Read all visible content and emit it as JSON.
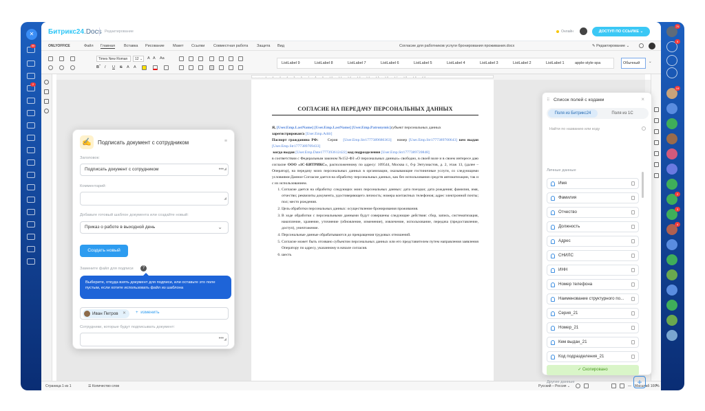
{
  "leftbar": {
    "close_icon": "close-icon",
    "badges": [
      "99",
      "2"
    ]
  },
  "rightbar": {
    "badges": [
      "70",
      "5",
      "19",
      "2",
      "3",
      "4"
    ]
  },
  "b24": {
    "brand_b24": "Битрикс24",
    "brand_docs": ".Docs",
    "mode": "Редактирование",
    "status": "Онлайн",
    "access_button": "ДОСТУП ПО ССЫЛКЕ"
  },
  "onlyoffice": {
    "logo": "ONLYOFFICE",
    "tabs": [
      "Файл",
      "Главная",
      "Вставка",
      "Рисование",
      "Макет",
      "Ссылки",
      "Совместная работа",
      "Защита",
      "Вид"
    ],
    "active_tab": "Главная",
    "file_title": "Согласие для работников услуги бронирования проживания.docx",
    "edit_mode": "Редактирование"
  },
  "toolbar": {
    "font": "Times New Roman",
    "size": "12",
    "aa": "Aa",
    "styles": [
      "ListLabel 9",
      "ListLabel 8",
      "ListLabel 7",
      "ListLabel 6",
      "ListLabel 5",
      "ListLabel 4",
      "ListLabel 3",
      "ListLabel 2",
      "ListLabel 1",
      "apple-style-spa"
    ],
    "active_style": "Обычный"
  },
  "document": {
    "title": "СОГЛАСИЕ НА ПЕРЕДАЧУ ПЕРСОНАЛЬНЫХ ДАННЫХ",
    "p1_a": "Я, ",
    "f_lastname": "[User.Emp.LastName]",
    "f_lastname2": "[User.Emp.LastName]",
    "f_patronymic": "[User.Emp.Patronymic]",
    "p1_b": "субъект персональных данных",
    "p2_a": "зарегистрирован/а ",
    "f_addr": "[User.Emp.Addr]",
    "p3_a": "Паспорт гражданина РФ:",
    "p3_b": "Серия",
    "f_str1": "[User.Emp.Str1777389686363]",
    "p3_c": "номер",
    "f_str2": "[User.Emp.Str1777389700643]",
    "p3_d": "кем выдан",
    "f_str3": "[User.Emp.Str1777389709433]",
    "p4_a": "когда выдан",
    "f_date": "[User.Emp.Date1777393612422]",
    "p4_b": "код подразделения",
    "f_str4": "[User.Emp.Str1777389720848]",
    "p5": "в соответствии с Федеральным законом №152-ФЗ «О персональных данных» свободно, в своей воле и в своем интересе даю согласие",
    "p5_org": "ООО «1С-БИТРИКС»",
    "p5_b": ", расположенному по адресу: 109544, Москва г., б-р Энтузиастов, д. 2, этаж 13, (далее – Оператор), на передачу моих персональных данных в организации, оказывающие гостиничные услуги, со следующими условиями:Данное Согласие дается на обработку персональных данных, как без использования средств автоматизации, так и с их использованием.",
    "items": [
      "Согласие дается на обработку следующих моих персональных данных: дата поездки; дата рождения; фамилия, имя, отчество; реквизиты документа, удостоверяющего личность; номера контактных телефонов; адрес электронной почты; пол; место рождения.",
      "Цель обработки персональных данных: осуществление бронирования проживания.",
      "В ходе обработки с персональными данными будут совершены следующие действия: сбор, запись, систематизация, накопление, хранение, уточнение (обновление, изменение), извлечение, использование, передача (предоставление, доступ), уничтожение.",
      "Персональные данные обрабатываются до прекращения трудовых отношений.",
      "Согласие может быть отозвано субъектом персональных данных или его представителем путем направления заявления Оператору по адресу, указанному в начале согласия.",
      "шесть"
    ]
  },
  "sign_panel": {
    "title": "Подписать документ с сотрудником",
    "header_label": "Заголовок:",
    "header_value": "Подписать документ с сотрудником",
    "comment_label": "Комментарий:",
    "comment_value": "",
    "template_label": "Добавьте готовый шаблон документа или создайте новый:",
    "template_value": "Приказ о работе в выходной день",
    "create_button": "Создать новый",
    "replace_label": "Замените файл для подписи",
    "tooltip": "Выберите, откуда взять документ для подписи, или оставьте это поле пустым, если хотите использовать файл из шаблона",
    "employee_chip": "Иван Петров",
    "add_link": "изменить",
    "signers_label": "Сотрудники, которые будут подписывать документ:",
    "signers_value": ""
  },
  "field_panel": {
    "title": "Список полей с кодами",
    "tab_b24": "Поля из Битрикс24",
    "tab_1c": "Поля из 1С",
    "search_placeholder": "Найти по названию или коду",
    "section_personal": "Личные данные",
    "items": [
      "Имя",
      "Фамилия",
      "Отчество",
      "Должность",
      "Адрес",
      "СНИЛС",
      "ИНН",
      "Номер телефона",
      "Наименование структурного по...",
      "Серия_21",
      "Номер_21",
      "Кем выдан_21",
      "Код подразделения_21"
    ],
    "copied": "Скопировано",
    "section_other": "Другие данные"
  },
  "statusbar": {
    "page": "Страница 1 из 1",
    "words": "Количество слов",
    "lang": "Русский – Россия",
    "zoom": "Масштаб 100%"
  }
}
